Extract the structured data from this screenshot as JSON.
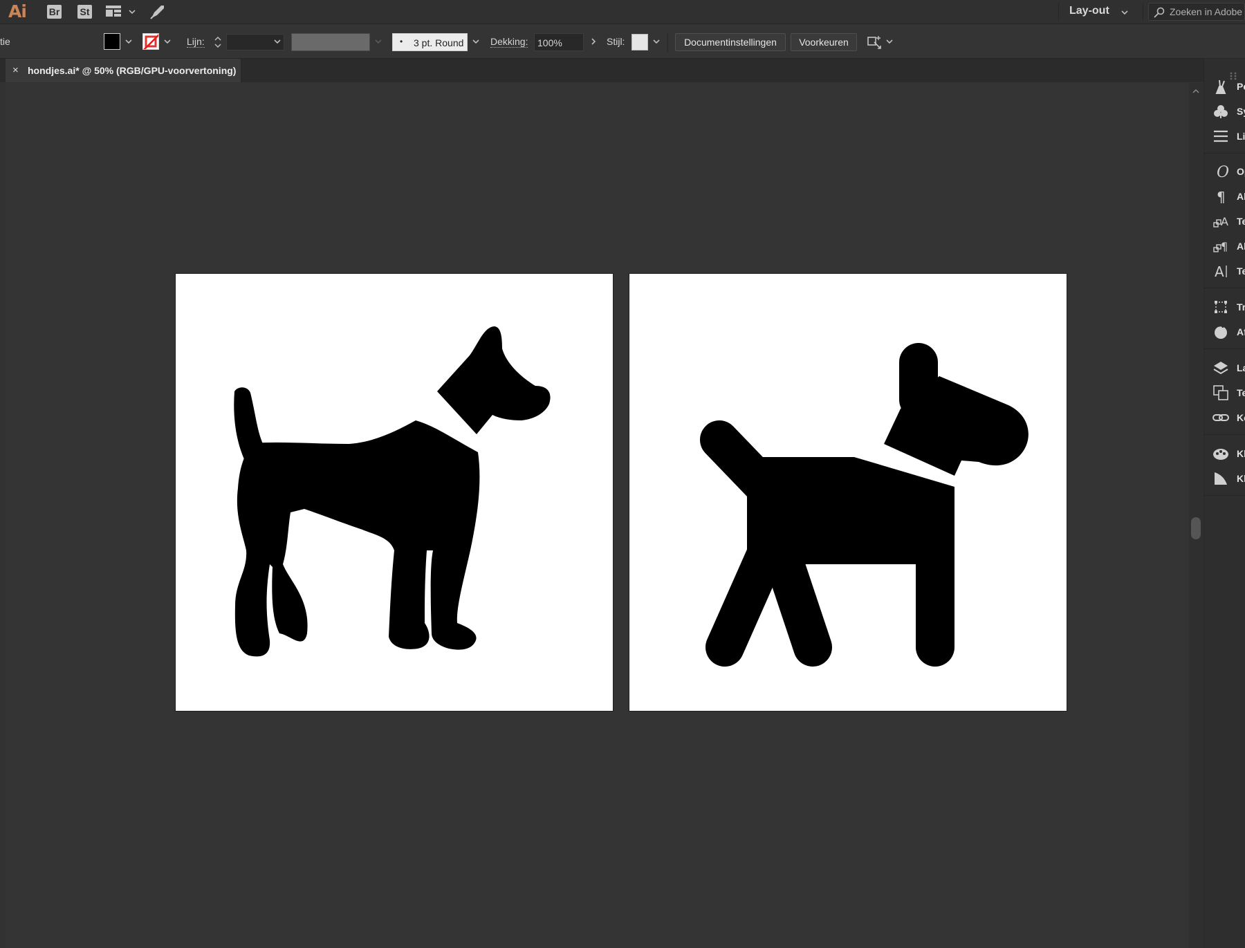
{
  "app": {
    "logo": "Ai",
    "bridge_label": "Br",
    "stock_label": "St",
    "workspace": "Lay-out",
    "search_placeholder": "Zoeken in Adobe"
  },
  "controlbar": {
    "left_cut_label": "tie",
    "stroke_label": "Lijn:",
    "brush_label": "3 pt. Round",
    "opacity_label": "Dekking:",
    "opacity_value": "100%",
    "style_label": "Stijl:",
    "doc_settings_button": "Documentinstellingen",
    "preferences_button": "Voorkeuren"
  },
  "document": {
    "tab_title": "hondjes.ai* @ 50% (RGB/GPU-voorvertoning)",
    "close_symbol": "×"
  },
  "artboards": [
    {
      "name": "artboard-1",
      "content": "standing dog silhouette with collar"
    },
    {
      "name": "artboard-2",
      "content": "geometric walking dog silhouette with collar"
    }
  ],
  "panels": [
    {
      "label": "Pe",
      "icon": "brush-icon"
    },
    {
      "label": "Sy",
      "icon": "symbols-icon"
    },
    {
      "label": "Li",
      "icon": "stroke-lines-icon"
    },
    {
      "label": "Op",
      "icon": "opentype-icon"
    },
    {
      "label": "Al",
      "icon": "paragraph-icon"
    },
    {
      "label": "Te",
      "icon": "character-styles-icon"
    },
    {
      "label": "Al",
      "icon": "paragraph-styles-icon"
    },
    {
      "label": "Te",
      "icon": "character-icon"
    },
    {
      "label": "Tr",
      "icon": "transform-icon"
    },
    {
      "label": "Af",
      "icon": "appearance-icon"
    },
    {
      "label": "La",
      "icon": "layers-icon"
    },
    {
      "label": "Te",
      "icon": "artboards-icon"
    },
    {
      "label": "Ko",
      "icon": "links-icon"
    },
    {
      "label": "Kl",
      "icon": "color-guide-icon"
    },
    {
      "label": "Kl",
      "icon": "gradient-icon"
    }
  ],
  "colors": {
    "accent_logo": "#c9855a",
    "background": "#323232",
    "artboard": "#ffffff",
    "silhouette": "#000000"
  }
}
